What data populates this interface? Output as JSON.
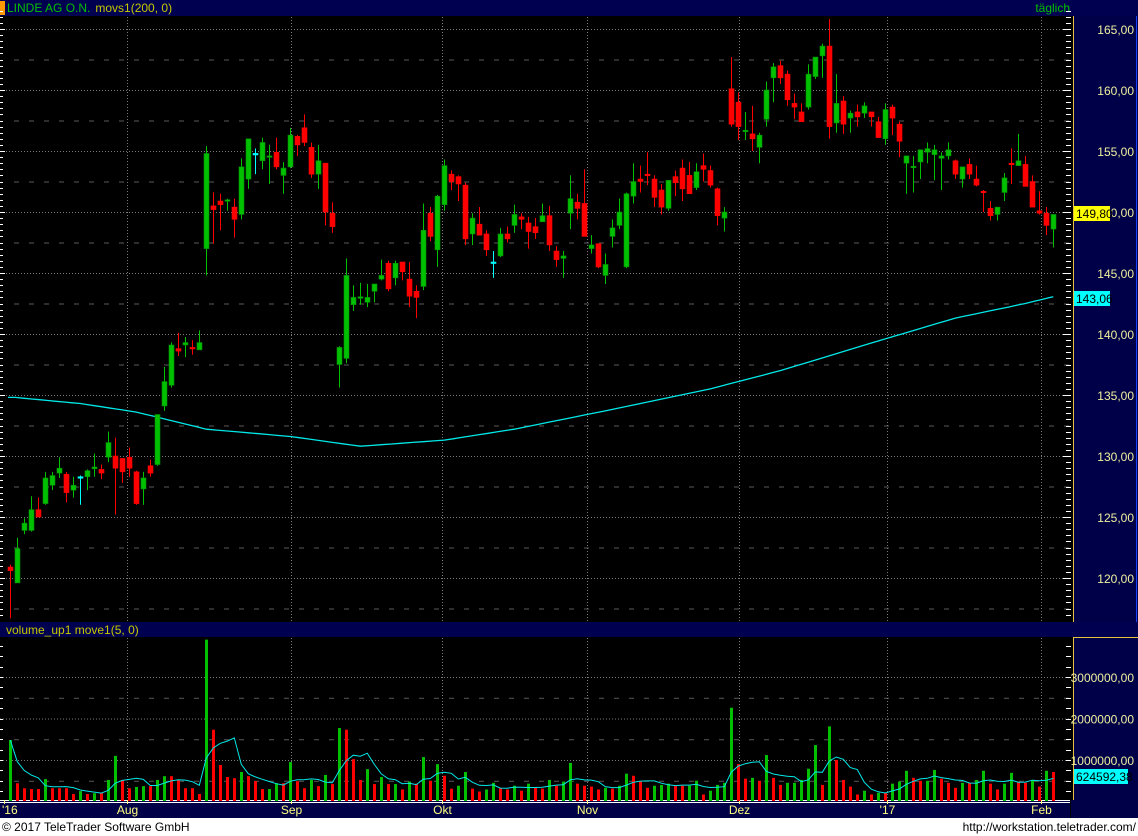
{
  "header": {
    "instrument": "LINDE AG O.N.",
    "indicator": "movs1(200, 0)",
    "period": "täglich"
  },
  "volume_header": {
    "indicator": "volume_up1 move1(5, 0)"
  },
  "price_axis": {
    "labels": [
      "165,00",
      "160,00",
      "155,00",
      "150,00",
      "145,00",
      "140,00",
      "135,00",
      "130,00",
      "125,00",
      "120,00"
    ],
    "last_price": "149,80",
    "ma_value": "143,06"
  },
  "volume_axis": {
    "labels": [
      "3000000,00",
      "2000000,00",
      "1000000,00"
    ],
    "last_value": "624592,38"
  },
  "footer": {
    "copyright": "© 2017 TeleTrader Software GmbH",
    "url": "http://workstation.teletrader.com/"
  },
  "colors": {
    "up": "#00c000",
    "down": "#ff0000",
    "doji": "#00ffff",
    "ma": "#00e8e8",
    "axis_text": "#f0f0a0",
    "panel": "#000048"
  },
  "chart_data": {
    "type": "candlestick",
    "title": "LINDE AG O.N.",
    "ylim": [
      116,
      166.5
    ],
    "volume_ylim_millions": [
      0,
      3.93
    ],
    "volume_unit": "millions",
    "grid": true,
    "x_ticks": [
      {
        "label": "'16",
        "index": -0.9
      },
      {
        "label": "Aug",
        "index": 16.67
      },
      {
        "label": "Sep",
        "index": 40.1
      },
      {
        "label": "Okt",
        "index": 61.7
      },
      {
        "label": "Nov",
        "index": 82.4
      },
      {
        "label": "Dez",
        "index": 104.1
      },
      {
        "label": "'17",
        "index": 125.2
      },
      {
        "label": "Feb",
        "index": 147.2
      }
    ],
    "y_ticks": [
      165,
      160,
      155,
      150,
      145,
      140,
      135,
      130,
      125,
      120
    ],
    "volume_ticks_millions": [
      3,
      2,
      1
    ],
    "ohlc": [
      [
        120.9,
        121.1,
        116.7,
        120.6
      ],
      [
        119.6,
        123.3,
        119.6,
        122.4
      ],
      [
        123.9,
        124.9,
        123.6,
        124.5
      ],
      [
        123.9,
        126.7,
        123.8,
        125.6
      ],
      [
        125.6,
        126.6,
        125.0,
        125.0
      ],
      [
        126.1,
        128.7,
        126.0,
        128.2
      ],
      [
        127.6,
        128.7,
        127.2,
        128.4
      ],
      [
        128.6,
        129.9,
        128.2,
        129.0
      ],
      [
        128.5,
        128.7,
        126.2,
        127.0
      ],
      [
        127.2,
        128.3,
        126.6,
        127.6
      ],
      [
        128.3,
        128.4,
        126.0,
        128.3
      ],
      [
        128.3,
        128.9,
        127.2,
        128.8
      ],
      [
        128.95,
        130.2,
        128.3,
        129.1
      ],
      [
        128.9,
        129.3,
        128.1,
        128.6
      ],
      [
        129.9,
        132.0,
        129.5,
        131.1
      ],
      [
        130.0,
        131.5,
        125.2,
        129.0
      ],
      [
        129.8,
        129.8,
        127.8,
        128.7
      ],
      [
        129.9,
        130.7,
        128.3,
        129.0
      ],
      [
        128.7,
        128.8,
        126.0,
        126.1
      ],
      [
        127.3,
        128.7,
        126.0,
        128.2
      ],
      [
        129.2,
        129.7,
        128.3,
        128.6
      ],
      [
        129.3,
        133.4,
        129.2,
        133.4
      ],
      [
        134.1,
        137.3,
        133.7,
        136.1
      ],
      [
        135.8,
        139.3,
        135.6,
        139.1
      ],
      [
        138.8,
        140.1,
        138.2,
        138.6
      ],
      [
        139.1,
        139.75,
        138.1,
        139.3
      ],
      [
        138.9,
        139.5,
        138.3,
        138.8
      ],
      [
        138.7,
        140.3,
        138.7,
        139.3
      ],
      [
        147.0,
        155.4,
        144.8,
        154.8
      ],
      [
        150.5,
        151.6,
        147.4,
        150.2
      ],
      [
        150.9,
        151.5,
        148.5,
        150.6
      ],
      [
        150.95,
        151.1,
        150.1,
        151.0
      ],
      [
        150.4,
        151.1,
        147.9,
        149.4
      ],
      [
        149.8,
        154.4,
        149.4,
        153.7
      ],
      [
        152.7,
        156.0,
        151.9,
        156.0
      ],
      [
        154.8,
        155.2,
        153.1,
        154.8
      ],
      [
        154.2,
        156.1,
        153.5,
        155.7
      ],
      [
        154.5,
        155.5,
        152.3,
        154.6
      ],
      [
        154.9,
        156.1,
        153.5,
        153.7
      ],
      [
        153.0,
        154.1,
        151.5,
        153.6
      ],
      [
        153.7,
        156.9,
        153.6,
        156.3
      ],
      [
        156.2,
        156.3,
        154.6,
        155.5
      ],
      [
        156.9,
        158.0,
        155.4,
        155.7
      ],
      [
        155.3,
        155.7,
        152.8,
        153.1
      ],
      [
        153.1,
        155.5,
        151.9,
        154.2
      ],
      [
        154.0,
        154.0,
        148.9,
        150.0
      ],
      [
        149.9,
        150.8,
        148.3,
        148.8
      ],
      [
        137.5,
        139.0,
        135.6,
        138.9
      ],
      [
        138.0,
        146.2,
        137.6,
        144.8
      ],
      [
        142.4,
        144.0,
        141.9,
        143.0
      ],
      [
        143.0,
        144.2,
        142.4,
        143.05
      ],
      [
        142.6,
        144.1,
        142.2,
        143.0
      ],
      [
        143.5,
        144.1,
        142.6,
        144.1
      ],
      [
        144.5,
        146.1,
        144.4,
        144.8
      ],
      [
        145.8,
        146.0,
        143.5,
        143.7
      ],
      [
        144.6,
        146.0,
        144.0,
        145.8
      ],
      [
        145.9,
        145.9,
        144.4,
        145.1
      ],
      [
        144.5,
        145.9,
        142.2,
        143.1
      ],
      [
        143.5,
        144.0,
        141.3,
        143.0
      ],
      [
        143.9,
        150.7,
        143.6,
        148.5
      ],
      [
        149.9,
        150.4,
        147.6,
        148.0
      ],
      [
        146.9,
        151.4,
        145.5,
        151.3
      ],
      [
        150.6,
        154.3,
        150.1,
        153.8
      ],
      [
        153.1,
        153.4,
        151.8,
        152.5
      ],
      [
        152.9,
        153.0,
        150.9,
        152.3
      ],
      [
        152.2,
        152.4,
        147.3,
        147.8
      ],
      [
        148.2,
        149.9,
        147.3,
        149.5
      ],
      [
        149.0,
        150.4,
        148.1,
        148.1
      ],
      [
        148.2,
        148.5,
        146.4,
        146.9
      ],
      [
        145.9,
        146.8,
        144.6,
        145.9
      ],
      [
        146.4,
        148.7,
        146.3,
        148.2
      ],
      [
        148.2,
        148.8,
        147.5,
        147.8
      ],
      [
        148.9,
        150.6,
        148.3,
        149.8
      ],
      [
        149.6,
        149.9,
        148.6,
        149.4
      ],
      [
        149.1,
        149.6,
        147.0,
        148.4
      ],
      [
        148.8,
        149.5,
        147.8,
        148.3
      ],
      [
        149.2,
        150.7,
        149.2,
        149.7
      ],
      [
        149.7,
        150.5,
        146.8,
        147.3
      ],
      [
        146.8,
        147.2,
        145.5,
        146.1
      ],
      [
        146.2,
        146.8,
        144.6,
        146.4
      ],
      [
        149.9,
        153.0,
        148.6,
        151.1
      ],
      [
        150.8,
        151.5,
        149.4,
        150.3
      ],
      [
        150.7,
        153.5,
        148.0,
        148.0
      ],
      [
        147.0,
        148.1,
        146.6,
        147.3
      ],
      [
        147.4,
        147.4,
        145.4,
        145.5
      ],
      [
        144.8,
        146.6,
        144.1,
        145.7
      ],
      [
        148.0,
        149.4,
        147.1,
        148.7
      ],
      [
        148.9,
        151.1,
        148.6,
        150.0
      ],
      [
        145.5,
        151.6,
        145.4,
        151.5
      ],
      [
        151.3,
        154.0,
        150.7,
        152.5
      ],
      [
        152.7,
        153.8,
        151.6,
        152.5
      ],
      [
        153.1,
        154.9,
        152.2,
        153.0
      ],
      [
        152.7,
        153.0,
        150.4,
        151.2
      ],
      [
        151.8,
        152.3,
        149.8,
        150.4
      ],
      [
        150.3,
        152.6,
        150.1,
        152.6
      ],
      [
        152.9,
        153.4,
        151.3,
        152.4
      ],
      [
        153.6,
        154.3,
        150.9,
        151.9
      ],
      [
        153.0,
        154.1,
        151.5,
        151.5
      ],
      [
        152.0,
        154.0,
        151.8,
        153.3
      ],
      [
        153.8,
        154.8,
        152.5,
        153.5
      ],
      [
        153.4,
        153.8,
        152.0,
        152.2
      ],
      [
        151.9,
        152.0,
        148.9,
        149.7
      ],
      [
        149.5,
        150.4,
        148.4,
        150.0
      ],
      [
        160.1,
        162.7,
        157.0,
        157.2
      ],
      [
        159.0,
        159.8,
        155.9,
        157.0
      ],
      [
        156.65,
        158.2,
        155.9,
        156.7
      ],
      [
        156.4,
        158.7,
        155.0,
        156.0
      ],
      [
        155.3,
        156.5,
        154.0,
        156.3
      ],
      [
        157.6,
        160.7,
        157.0,
        160.0
      ],
      [
        161.0,
        162.2,
        159.0,
        161.9
      ],
      [
        162.0,
        162.4,
        160.5,
        161.0
      ],
      [
        161.3,
        161.6,
        158.7,
        159.2
      ],
      [
        158.9,
        159.7,
        157.6,
        158.6
      ],
      [
        158.2,
        158.9,
        157.4,
        157.4
      ],
      [
        158.6,
        162.1,
        158.4,
        161.3
      ],
      [
        161.1,
        162.7,
        160.9,
        162.7
      ],
      [
        162.8,
        163.8,
        161.0,
        163.6
      ],
      [
        163.6,
        165.8,
        156.0,
        157.0
      ],
      [
        157.3,
        161.3,
        156.5,
        158.9
      ],
      [
        159.1,
        159.5,
        156.4,
        157.2
      ],
      [
        157.7,
        158.3,
        156.5,
        158.1
      ],
      [
        158.2,
        158.8,
        157.0,
        157.8
      ],
      [
        158.1,
        159.0,
        157.7,
        158.7
      ],
      [
        158.2,
        158.2,
        157.0,
        157.8
      ],
      [
        157.4,
        157.8,
        156.1,
        156.1
      ],
      [
        156.0,
        158.9,
        155.5,
        158.4
      ],
      [
        158.6,
        158.8,
        156.3,
        157.7
      ],
      [
        157.2,
        157.4,
        154.5,
        155.8
      ],
      [
        154.0,
        154.6,
        151.5,
        154.6
      ],
      [
        153.7,
        154.6,
        151.6,
        153.75
      ],
      [
        154.1,
        155.1,
        152.7,
        155.1
      ],
      [
        154.9,
        155.7,
        154.0,
        155.2
      ],
      [
        154.7,
        155.5,
        152.6,
        155.1
      ],
      [
        154.4,
        154.9,
        151.8,
        154.6
      ],
      [
        154.6,
        155.7,
        154.3,
        155.1
      ],
      [
        154.2,
        154.3,
        152.7,
        153.1
      ],
      [
        152.7,
        153.7,
        152.0,
        153.7
      ],
      [
        153.9,
        154.4,
        152.7,
        153.1
      ],
      [
        152.7,
        153.8,
        152.1,
        152.2
      ],
      [
        151.7,
        151.8,
        150.0,
        151.6
      ],
      [
        150.3,
        150.9,
        149.3,
        149.7
      ],
      [
        149.8,
        150.4,
        149.3,
        150.4
      ],
      [
        151.6,
        153.2,
        150.9,
        152.8
      ],
      [
        154.0,
        155.2,
        152.3,
        153.95
      ],
      [
        153.8,
        156.4,
        153.8,
        154.2
      ],
      [
        153.9,
        154.6,
        152.1,
        152.1
      ],
      [
        152.5,
        153.0,
        150.4,
        150.4
      ],
      [
        150.1,
        151.7,
        149.8,
        149.9
      ],
      [
        149.9,
        150.4,
        148.1,
        148.9
      ],
      [
        148.6,
        149.8,
        147.1,
        149.8
      ]
    ],
    "ma200_anchors": [
      [
        0.7,
        134.8
      ],
      [
        10,
        134.3
      ],
      [
        18,
        133.6
      ],
      [
        28,
        132.2
      ],
      [
        40,
        131.6
      ],
      [
        50,
        130.8
      ],
      [
        62,
        131.3
      ],
      [
        72,
        132.2
      ],
      [
        85,
        133.7
      ],
      [
        100,
        135.5
      ],
      [
        110,
        137.0
      ],
      [
        125,
        139.6
      ],
      [
        135,
        141.3
      ],
      [
        145,
        142.5
      ],
      [
        149,
        143.06
      ]
    ],
    "volume": [
      1.48,
      0.44,
      0.32,
      0.3,
      0.3,
      0.54,
      0.32,
      0.32,
      0.32,
      0.18,
      0.25,
      0.18,
      0.2,
      0.2,
      0.52,
      1.1,
      0.52,
      0.32,
      0.35,
      0.37,
      0.37,
      0.52,
      0.61,
      0.61,
      0.52,
      0.32,
      0.32,
      0.18,
      3.9,
      1.73,
      0.88,
      0.59,
      0.56,
      0.71,
      0.61,
      0.49,
      0.3,
      0.3,
      0.44,
      0.44,
      0.95,
      0.49,
      0.32,
      0.52,
      0.37,
      0.64,
      0.42,
      1.77,
      1.73,
      1.02,
      0.52,
      0.78,
      0.42,
      0.59,
      0.42,
      0.42,
      0.29,
      0.48,
      0.43,
      1.07,
      0.5,
      0.9,
      0.62,
      0.31,
      0.38,
      0.71,
      0.31,
      0.24,
      0.29,
      0.45,
      0.33,
      0.29,
      0.38,
      0.26,
      0.43,
      0.33,
      0.31,
      0.52,
      0.38,
      0.48,
      0.93,
      0.43,
      0.38,
      0.36,
      0.29,
      0.33,
      0.31,
      0.38,
      0.67,
      0.62,
      0.48,
      0.33,
      0.38,
      0.4,
      0.43,
      0.38,
      0.38,
      0.38,
      0.5,
      0.17,
      0.26,
      0.4,
      0.45,
      2.26,
      0.9,
      0.55,
      0.57,
      0.5,
      1.12,
      0.57,
      0.4,
      0.45,
      0.45,
      0.52,
      0.79,
      1.36,
      0.4,
      1.81,
      1.0,
      0.52,
      0.36,
      0.17,
      0.26,
      0.17,
      0.21,
      0.21,
      0.43,
      0.48,
      0.74,
      0.57,
      0.5,
      0.5,
      0.76,
      0.55,
      0.45,
      0.33,
      0.45,
      0.45,
      0.52,
      0.74,
      0.43,
      0.29,
      0.43,
      0.69,
      0.48,
      0.45,
      0.52,
      0.36,
      0.74,
      0.71
    ],
    "volume_direction": "GRRRRGRRRRGRGRGGRRGGRGGRRRRRGRRRRGRRRGGRGRRGRGRGRRRGRGRGRGRGRGRRGGRRGGRRGRGRRGRGGRRRRGRGGRRRGGGRRGGRGGGGRRGRGRRGGGGGRGRRRRGRGRGGGRRGGRRRGRGGRRGGRRGRGR"
  }
}
